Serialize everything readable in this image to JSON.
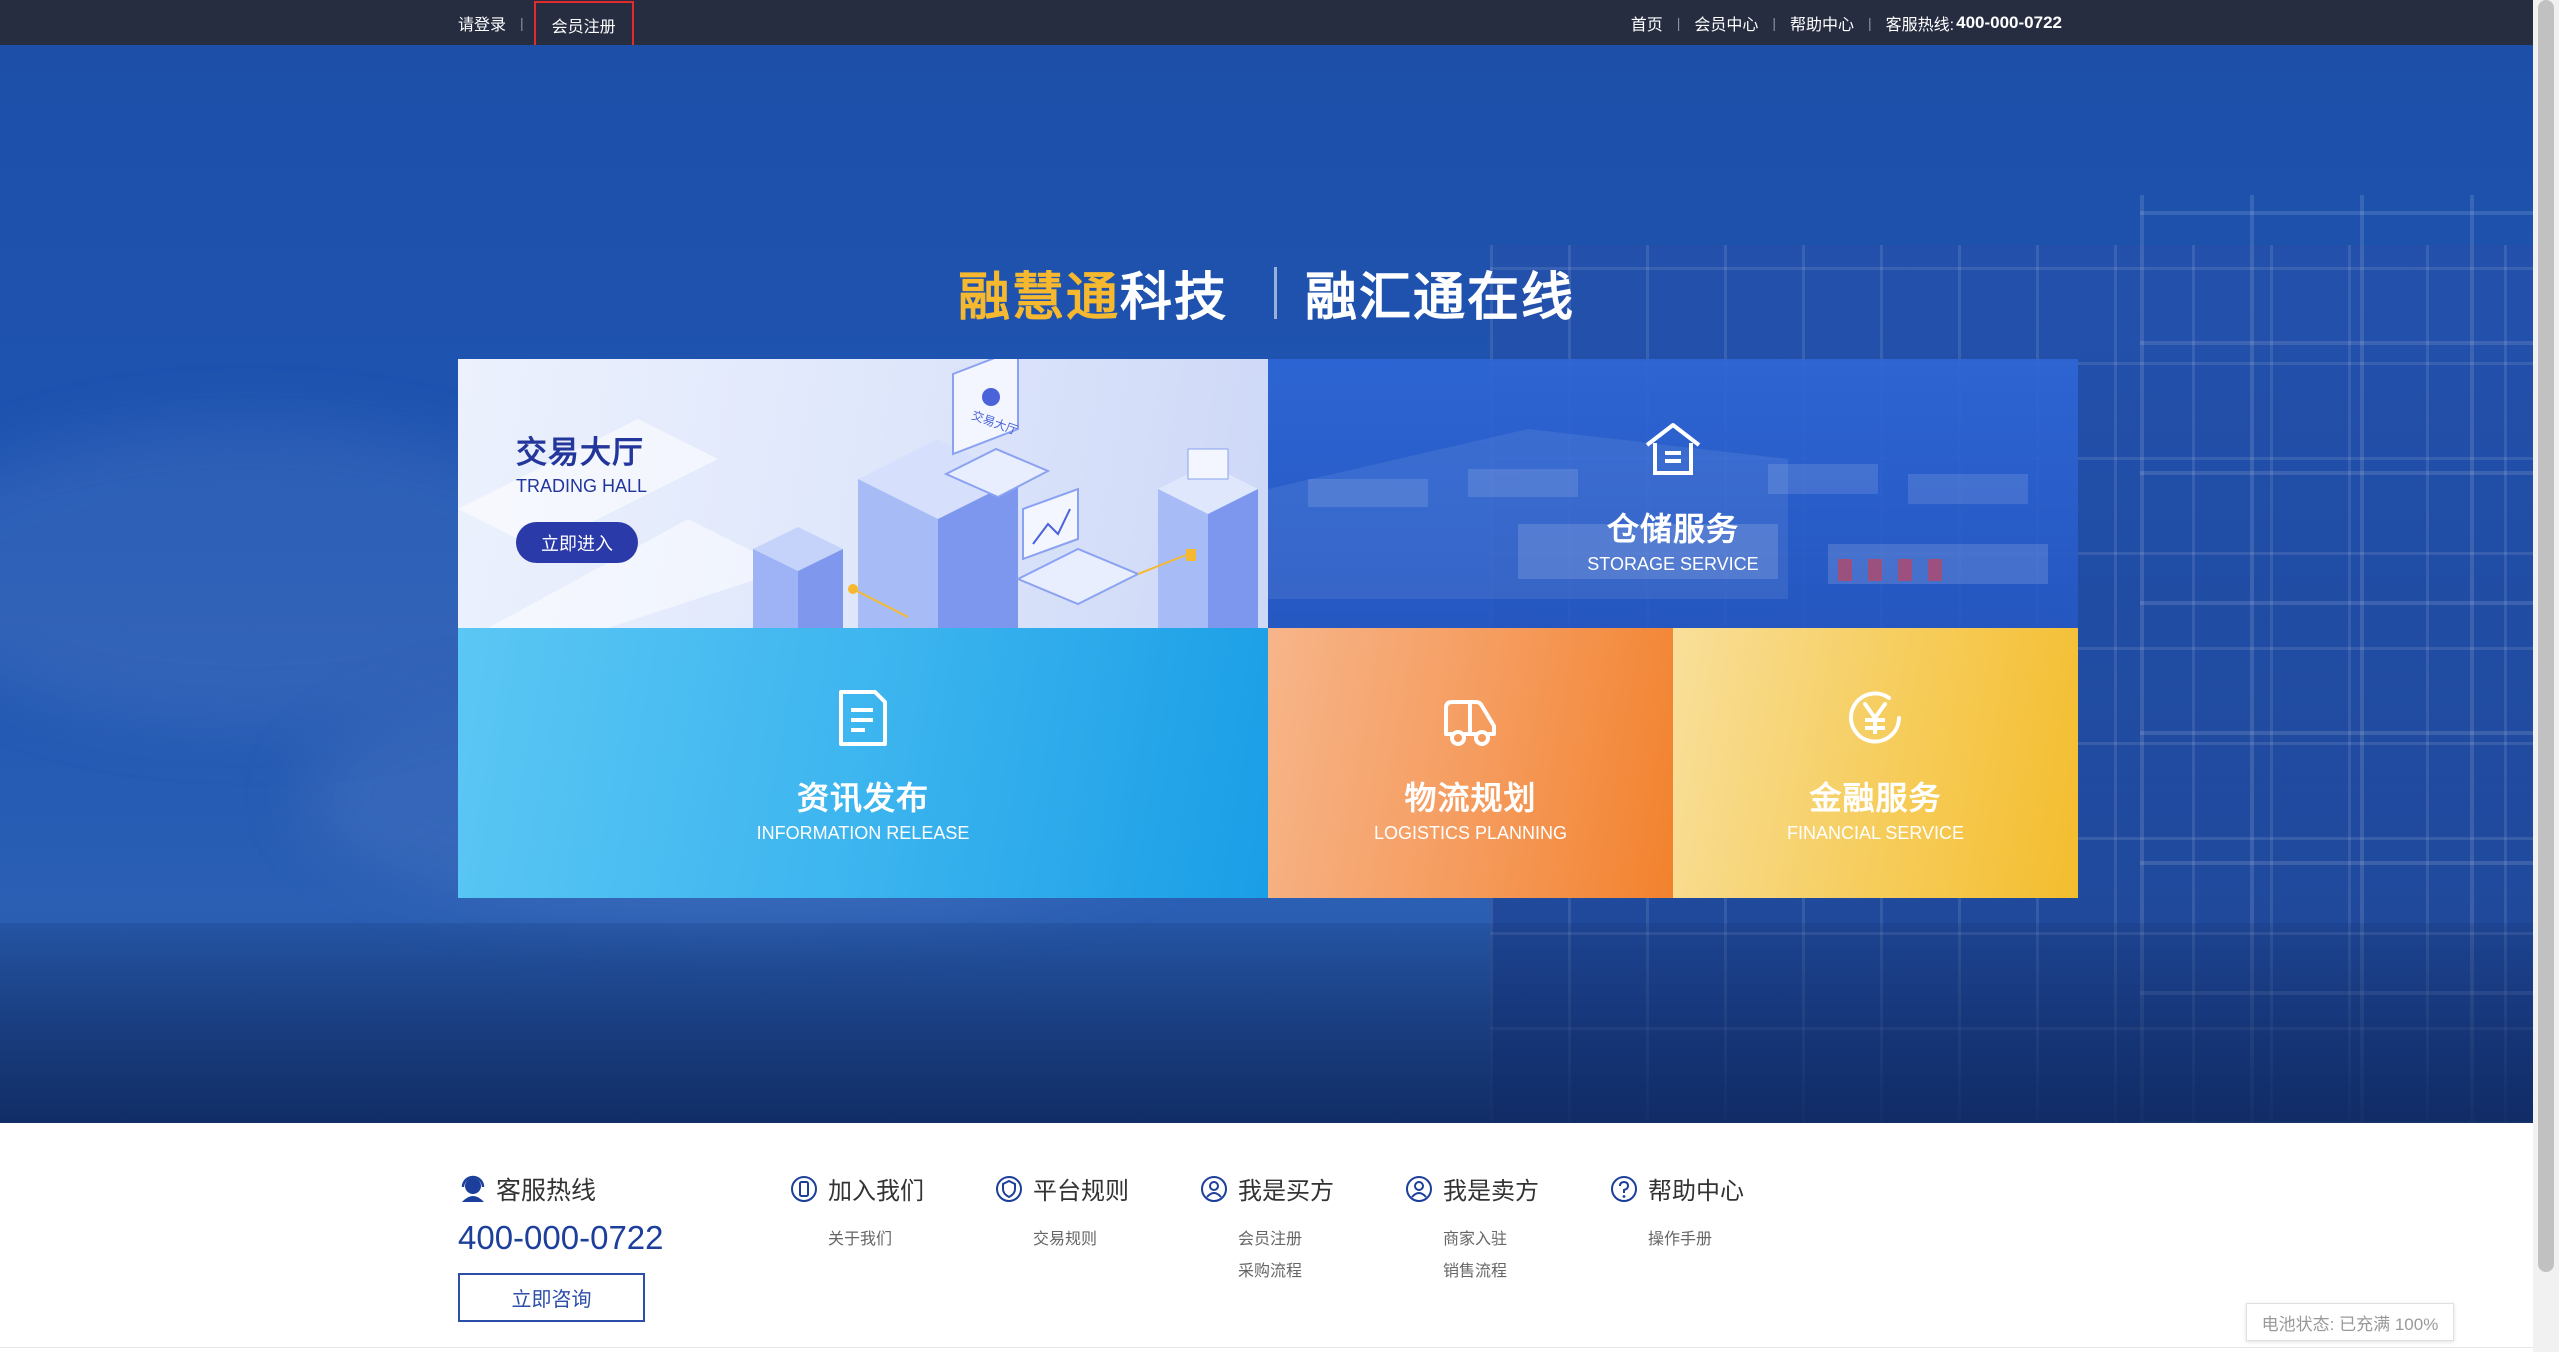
{
  "topbar": {
    "login": "请登录",
    "register": "会员注册",
    "home": "首页",
    "member_center": "会员中心",
    "help_center": "帮助中心",
    "hotline_label": "客服热线:",
    "hotline_number": "400-000-0722"
  },
  "hero": {
    "brand_gold": "融慧通",
    "brand_white": "科技",
    "slogan": "融汇通在线"
  },
  "tiles": {
    "trading": {
      "cn": "交易大厅",
      "en": "TRADING HALL",
      "button": "立即进入",
      "screen_text": "交易大厅"
    },
    "storage": {
      "cn": "仓储服务",
      "en": "STORAGE SERVICE"
    },
    "info": {
      "cn": "资讯发布",
      "en": "INFORMATION RELEASE"
    },
    "logistics": {
      "cn": "物流规划",
      "en": "LOGISTICS PLANNING"
    },
    "finance": {
      "cn": "金融服务",
      "en": "FINANCIAL SERVICE"
    }
  },
  "footer": {
    "hotline_label": "客服热线",
    "hotline_number": "400-000-0722",
    "consult_button": "立即咨询",
    "columns": [
      {
        "title": "加入我们",
        "icon": "phone-icon",
        "links": [
          "关于我们"
        ]
      },
      {
        "title": "平台规则",
        "icon": "shield-icon",
        "links": [
          "交易规则"
        ]
      },
      {
        "title": "我是买方",
        "icon": "user-icon",
        "links": [
          "会员注册",
          "采购流程"
        ]
      },
      {
        "title": "我是卖方",
        "icon": "user-icon",
        "links": [
          "商家入驻",
          "销售流程"
        ]
      },
      {
        "title": "帮助中心",
        "icon": "question-icon",
        "links": [
          "操作手册"
        ]
      }
    ]
  },
  "status_tip": "电池状态: 已充满 100%",
  "colors": {
    "topbar": "#262d40",
    "brand_gold": "#f5b82e",
    "accent_blue": "#1d3f9c",
    "highlight_red": "#e32b2b"
  }
}
